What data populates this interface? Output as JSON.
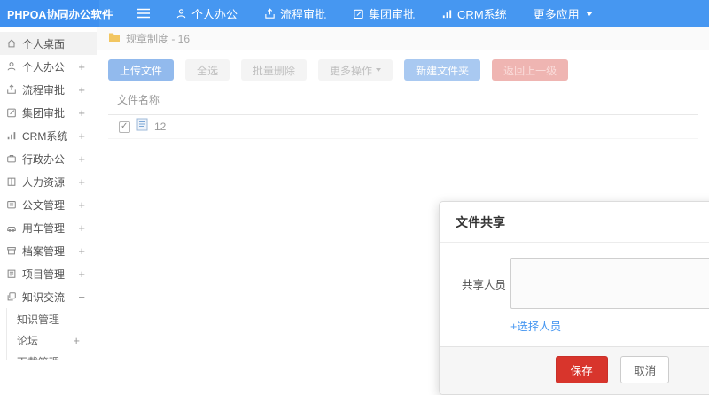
{
  "header": {
    "logo": "PHPOA协同办公软件",
    "menu": [
      {
        "label": "个人办公",
        "icon": "user-icon"
      },
      {
        "label": "流程审批",
        "icon": "upload-icon"
      },
      {
        "label": "集团审批",
        "icon": "edit-icon"
      },
      {
        "label": "CRM系统",
        "icon": "chart-icon"
      },
      {
        "label": "更多应用",
        "icon": "caret-down-icon"
      }
    ]
  },
  "sidebar": {
    "items": [
      {
        "label": "个人桌面",
        "icon": "home-icon"
      },
      {
        "label": "个人办公",
        "icon": "user-icon",
        "toggle": "+"
      },
      {
        "label": "流程审批",
        "icon": "upload-icon",
        "toggle": "+"
      },
      {
        "label": "集团审批",
        "icon": "edit-icon",
        "toggle": "+"
      },
      {
        "label": "CRM系统",
        "icon": "chart-icon",
        "toggle": "+"
      },
      {
        "label": "行政办公",
        "icon": "briefcase-icon",
        "toggle": "+"
      },
      {
        "label": "人力资源",
        "icon": "book-icon",
        "toggle": "+"
      },
      {
        "label": "公文管理",
        "icon": "document-icon",
        "toggle": "+"
      },
      {
        "label": "用车管理",
        "icon": "car-icon",
        "toggle": "+"
      },
      {
        "label": "档案管理",
        "icon": "archive-icon",
        "toggle": "+"
      },
      {
        "label": "项目管理",
        "icon": "board-icon",
        "toggle": "+"
      },
      {
        "label": "知识交流",
        "icon": "share-icon",
        "toggle": "−",
        "children": [
          {
            "label": "知识管理"
          },
          {
            "label": "论坛",
            "toggle": "+"
          },
          {
            "label": "下载管理"
          }
        ]
      }
    ]
  },
  "breadcrumb": {
    "text": "规章制度 - 16"
  },
  "toolbar": {
    "upload": "上传文件",
    "select_all": "全选",
    "batch_delete": "批量删除",
    "more_actions": "更多操作",
    "new_folder": "新建文件夹",
    "go_back": "返回上一级"
  },
  "file_list": {
    "name_header": "文件名称",
    "rows": [
      {
        "name": "12",
        "checked": true
      }
    ]
  },
  "modal": {
    "title": "文件共享",
    "share_label": "共享人员",
    "textarea_value": "",
    "select_people_link": "+选择人员",
    "save": "保存",
    "cancel": "取消"
  },
  "colors": {
    "header_blue": "#4697f1",
    "logo_blue": "#3e90f0",
    "primary_button_blue": "#92baed",
    "back_button_red": "#efb5b2",
    "save_button_red": "#d8352c",
    "link_blue": "#4797f1",
    "folder_icon_orange": "#f2c661"
  }
}
